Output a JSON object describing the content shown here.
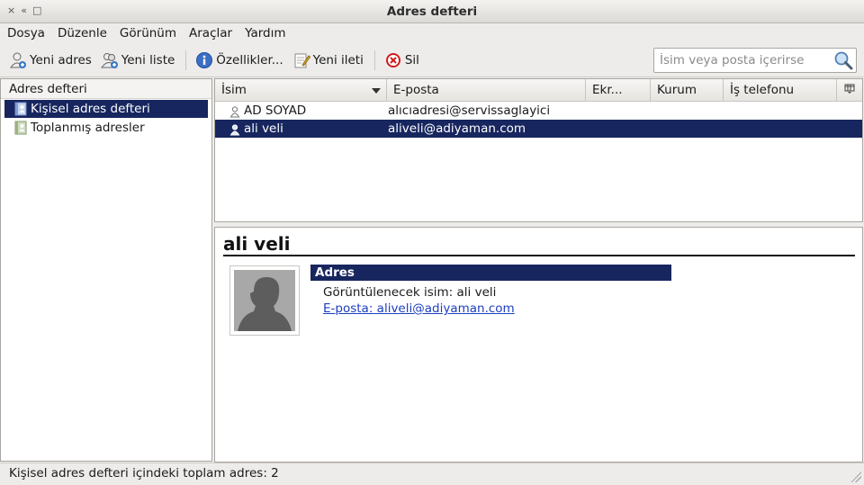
{
  "window": {
    "title": "Adres defteri",
    "controls": [
      "×",
      "«",
      "□"
    ]
  },
  "menubar": {
    "items": [
      {
        "label": "Dosya"
      },
      {
        "label": "Düzenle"
      },
      {
        "label": "Görünüm"
      },
      {
        "label": "Araçlar"
      },
      {
        "label": "Yardım"
      }
    ]
  },
  "toolbar": {
    "new_contact": "Yeni adres",
    "new_list": "Yeni liste",
    "properties": "Özellikler...",
    "new_message": "Yeni ileti",
    "delete": "Sil",
    "search_placeholder": "İsim veya posta içerirse",
    "icons": {
      "new_contact": "new-contact-icon",
      "new_list": "new-list-icon",
      "properties": "info-icon",
      "new_message": "compose-icon",
      "delete": "delete-icon",
      "search": "magnifier-icon"
    }
  },
  "sidebar": {
    "header": "Adres defteri",
    "books": [
      {
        "label": "Kişisel adres defteri",
        "selected": true
      },
      {
        "label": "Toplanmış adresler",
        "selected": false
      }
    ]
  },
  "contacts": {
    "columns": [
      "İsim",
      "E-posta",
      "Ekr...",
      "Kurum",
      "İş telefonu"
    ],
    "rows": [
      {
        "name": "AD SOYAD",
        "email": "alıcıadresi@servissaglayici",
        "selected": false
      },
      {
        "name": "ali veli",
        "email": "aliveli@adiyaman.com",
        "selected": true
      }
    ]
  },
  "detail": {
    "name": "ali veli",
    "section": "Adres",
    "display_name_line": "Görüntülenecek isim: ali veli",
    "email_line": "E-posta: aliveli@adiyaman.com"
  },
  "status": {
    "text": "Kişisel adres defteri içindeki toplam adres: 2"
  },
  "colors": {
    "selection": "#17265e",
    "link": "#1d3fbf"
  }
}
